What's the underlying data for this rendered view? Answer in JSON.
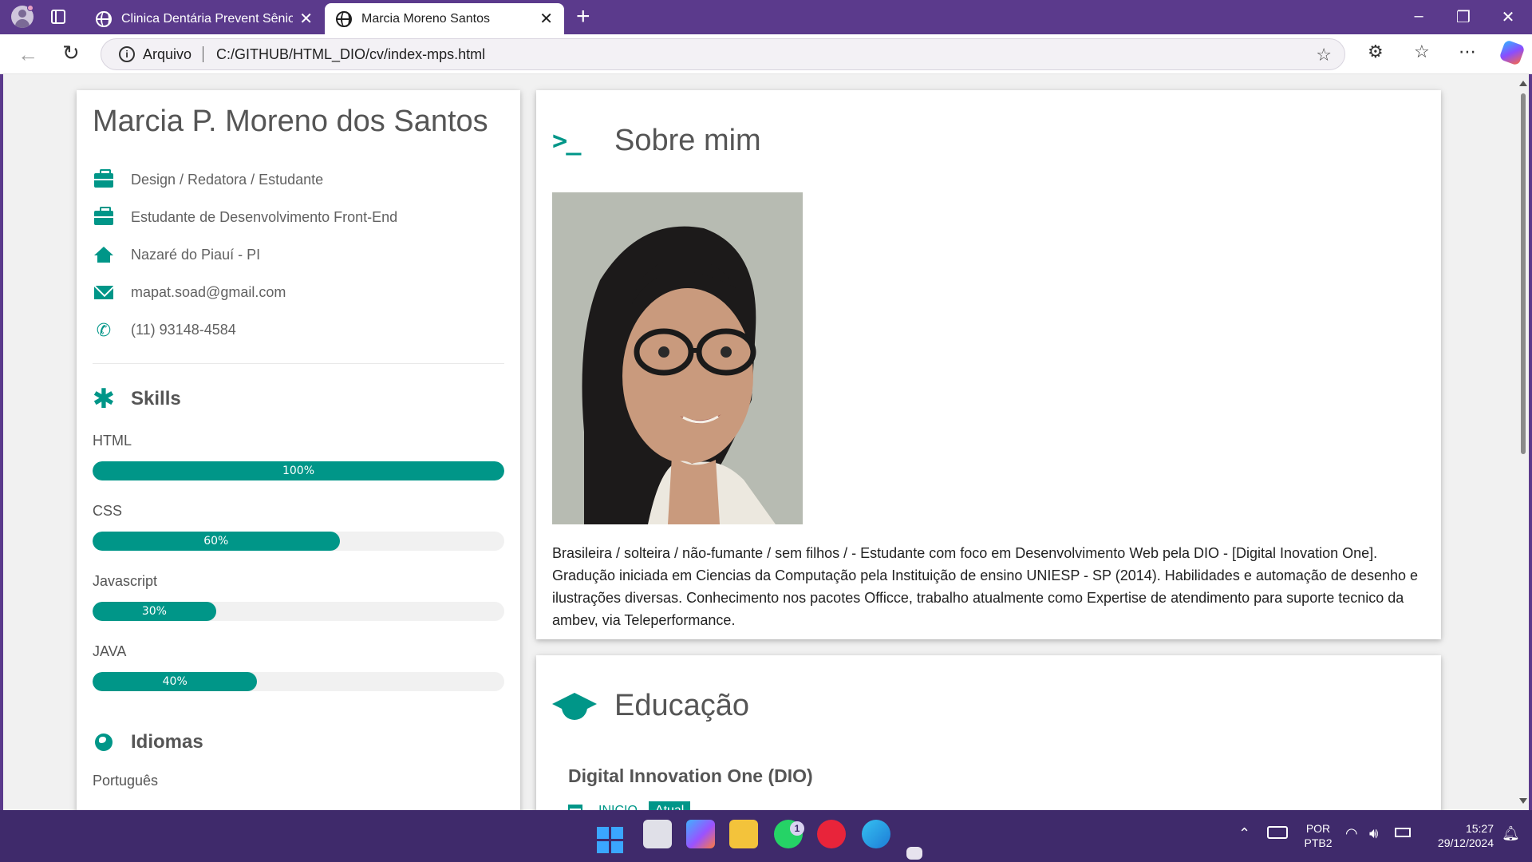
{
  "browser": {
    "tabs": [
      {
        "title": "Clinica Dentária Prevent Sênior"
      },
      {
        "title": "Marcia Moreno Santos"
      }
    ],
    "address": {
      "label": "Arquivo",
      "url": "C:/GITHUB/HTML_DIO/cv/index-mps.html"
    }
  },
  "profile": {
    "name": "Marcia P. Moreno dos Santos",
    "info": [
      {
        "icon": "briefcase-icon",
        "text": "Design / Redatora / Estudante"
      },
      {
        "icon": "briefcase-icon",
        "text": "Estudante de Desenvolvimento Front-End"
      },
      {
        "icon": "home-icon",
        "text": "Nazaré do Piauí - PI"
      },
      {
        "icon": "envelope-icon",
        "text": "mapat.soad@gmail.com"
      },
      {
        "icon": "phone-icon",
        "text": "(11) 93148-4584"
      }
    ]
  },
  "skills": {
    "heading": "Skills",
    "items": [
      {
        "name": "HTML",
        "percent": 100,
        "label": "100%"
      },
      {
        "name": "CSS",
        "percent": 60,
        "label": "60%"
      },
      {
        "name": "Javascript",
        "percent": 30,
        "label": "30%"
      },
      {
        "name": "JAVA",
        "percent": 40,
        "label": "40%"
      }
    ]
  },
  "languages": {
    "heading": "Idiomas",
    "items": [
      "Português"
    ]
  },
  "about": {
    "heading": "Sobre mim",
    "text": "Brasileira / solteira / não-fumante / sem filhos / - Estudante com foco em Desenvolvimento Web pela DIO - [Digital Inovation One]. Gradução iniciada em Ciencias da Computação pela Instituição de ensino UNIESP - SP (2014). Habilidades e automação de desenho e ilustrações diversas. Conhecimento nos pacotes Officce, trabalho atualmente como Expertise de atendimento para suporte tecnico da ambev, via Teleperformance."
  },
  "education": {
    "heading": "Educação",
    "school": "Digital Innovation One (DIO)",
    "start_label": "INICIO",
    "status": "Atual"
  },
  "taskbar": {
    "whatsapp_badge": "1",
    "language": "POR",
    "layout": "PTB2",
    "time": "15:27",
    "date": "29/12/2024"
  },
  "colors": {
    "accent": "#009688",
    "browser_frame": "#5b3a8c",
    "taskbar": "#3f2a6b"
  }
}
